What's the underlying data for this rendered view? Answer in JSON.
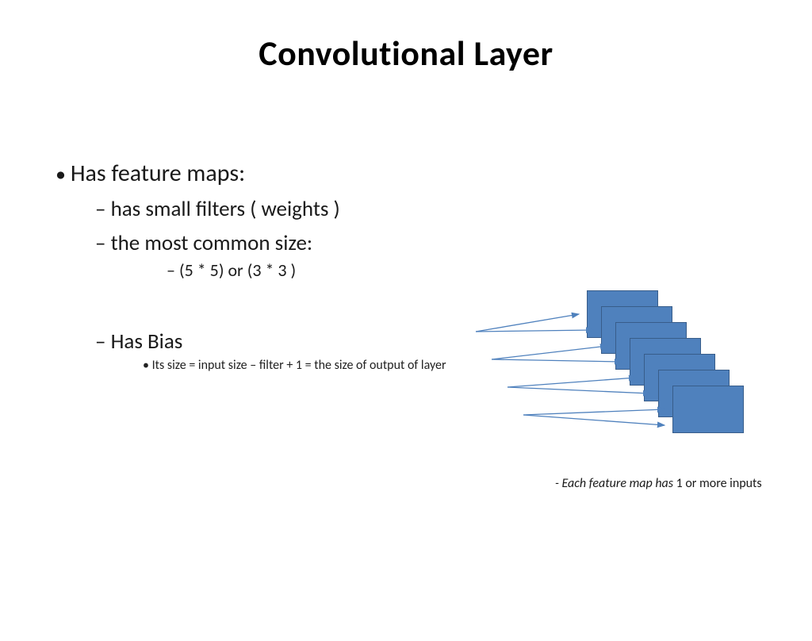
{
  "title": "Convolutional Layer",
  "bullets": {
    "l1": "Has feature maps:",
    "l2a": "has small filters ( weights )",
    "l2b": "the most common size:",
    "l3a": "(5 * 5) or (3 * 3 )",
    "bias_head": "Has Bias",
    "bias_detail": "Its size = input size – filter + 1  = the size of output of  layer"
  },
  "caption": {
    "prefix": "- ",
    "ital": "Each feature map has ",
    "rest": "1 or more inputs"
  },
  "diagram": {
    "maps_count": 7,
    "map_fill": "#4f81bd",
    "map_stroke": "#385d8a",
    "arrow_stroke": "#4f81bd"
  }
}
